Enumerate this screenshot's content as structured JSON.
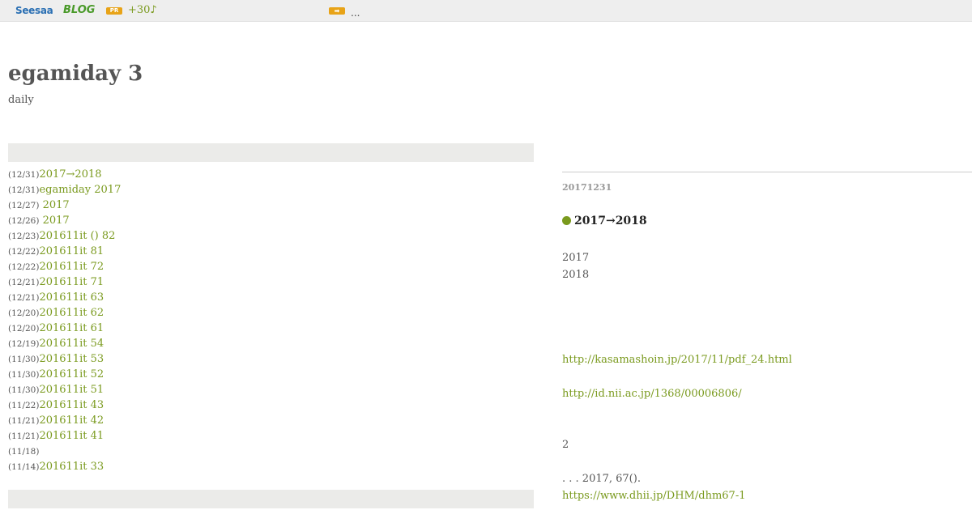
{
  "topbar": {
    "logo_seesaa": "Seesaa",
    "logo_blog": "BLOG",
    "pr_badge": "PR",
    "pr_text": "+30♪",
    "arrow_badge": "➡",
    "ellipsis": "..."
  },
  "header": {
    "title": "egamiday 3",
    "description": "daily"
  },
  "recent_articles": [
    {
      "date": "(12/31)",
      "title": "2017→2018"
    },
    {
      "date": "(12/31)",
      "title": "egamiday 2017"
    },
    {
      "date": "(12/27)",
      "title": " 2017"
    },
    {
      "date": "(12/26)",
      "title": " 2017"
    },
    {
      "date": "(12/23)",
      "title": "201611it () 82"
    },
    {
      "date": "(12/22)",
      "title": "201611it  81"
    },
    {
      "date": "(12/22)",
      "title": "201611it  72"
    },
    {
      "date": "(12/21)",
      "title": "201611it  71"
    },
    {
      "date": "(12/21)",
      "title": "201611it  63"
    },
    {
      "date": "(12/20)",
      "title": "201611it  62"
    },
    {
      "date": "(12/20)",
      "title": "201611it  61"
    },
    {
      "date": "(12/19)",
      "title": "201611it  54"
    },
    {
      "date": "(11/30)",
      "title": "201611it  53"
    },
    {
      "date": "(11/30)",
      "title": "201611it  52"
    },
    {
      "date": "(11/30)",
      "title": "201611it  51"
    },
    {
      "date": "(11/22)",
      "title": "201611it  43"
    },
    {
      "date": "(11/21)",
      "title": "201611it  42"
    },
    {
      "date": "(11/21)",
      "title": "201611it  41"
    },
    {
      "date": "(11/18)",
      "title": ""
    },
    {
      "date": "(11/14)",
      "title": "201611it  33"
    }
  ],
  "entry": {
    "date": "20171231",
    "title": "2017→2018",
    "line_2017": "2017",
    "line_2018": "2018",
    "link1": "http://kasamashoin.jp/2017/11/pdf_24.html",
    "link2": "http://id.nii.ac.jp/1368/00006806/",
    "line_2": "2",
    "citation": ". . . 2017, 67().",
    "link3": "https://www.dhii.jp/DHM/dhm67-1"
  },
  "colors": {
    "accent": "#7a9a1e",
    "topbar_bg": "#eeeeee",
    "bar_bg": "#ebebe9",
    "badge": "#e8a317"
  }
}
